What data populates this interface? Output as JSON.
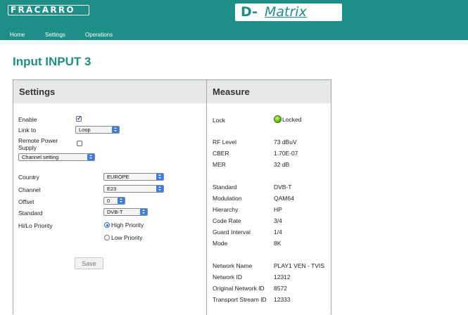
{
  "brand": {
    "left_logo": "FRACARRO",
    "right_logo_prefix": "D-",
    "right_logo_suffix": "Matrix"
  },
  "nav": {
    "items": [
      "Home",
      "Settings",
      "Operations"
    ]
  },
  "page": {
    "title": "Input INPUT 3"
  },
  "settings": {
    "heading": "Settings",
    "enable_label": "Enable",
    "enable_checked": true,
    "link_to_label": "Link to",
    "link_to_value": "Loop",
    "remote_power_label_1": "Remote Power",
    "remote_power_label_2": "Supply",
    "remote_power_checked": false,
    "mode_select_value": "Channel setting",
    "country_label": "Country",
    "country_value": "EUROPE",
    "channel_label": "Channel",
    "channel_value": "E23",
    "offset_label": "Offset",
    "offset_value": "0",
    "standard_label": "Standard",
    "standard_value": "DVB-T",
    "priority_label": "Hi/Lo Priority",
    "priority_options": [
      "High Priority",
      "Low Priority"
    ],
    "priority_selected": "High Priority",
    "save_label": "Save"
  },
  "measure": {
    "heading": "Measure",
    "lock_label": "Lock",
    "lock_value": "Locked",
    "lock_color": "#5aa812",
    "rows_signal": [
      {
        "label": "RF Level",
        "value": "73 dBuV"
      },
      {
        "label": "CBER",
        "value": "1.70E-07"
      },
      {
        "label": "MER",
        "value": "32 dB"
      }
    ],
    "rows_mod": [
      {
        "label": "Standard",
        "value": "DVB-T"
      },
      {
        "label": "Modulation",
        "value": "QAM64"
      },
      {
        "label": "Hierarchy",
        "value": "HP"
      },
      {
        "label": "Code Rate",
        "value": "3/4"
      },
      {
        "label": "Guard Interval",
        "value": "1/4"
      },
      {
        "label": "Mode",
        "value": "8K"
      }
    ],
    "rows_net": [
      {
        "label": "Network Name",
        "value": "PLAY1 VEN - TVIS"
      },
      {
        "label": "Network ID",
        "value": "12312"
      },
      {
        "label": "Original Network ID",
        "value": "8572"
      },
      {
        "label": "Transport Stream ID",
        "value": "12333"
      }
    ]
  },
  "colors": {
    "accent": "#1d8f86",
    "select_arrow": "#3b7de0",
    "panel_header": "#e8e8e8"
  }
}
